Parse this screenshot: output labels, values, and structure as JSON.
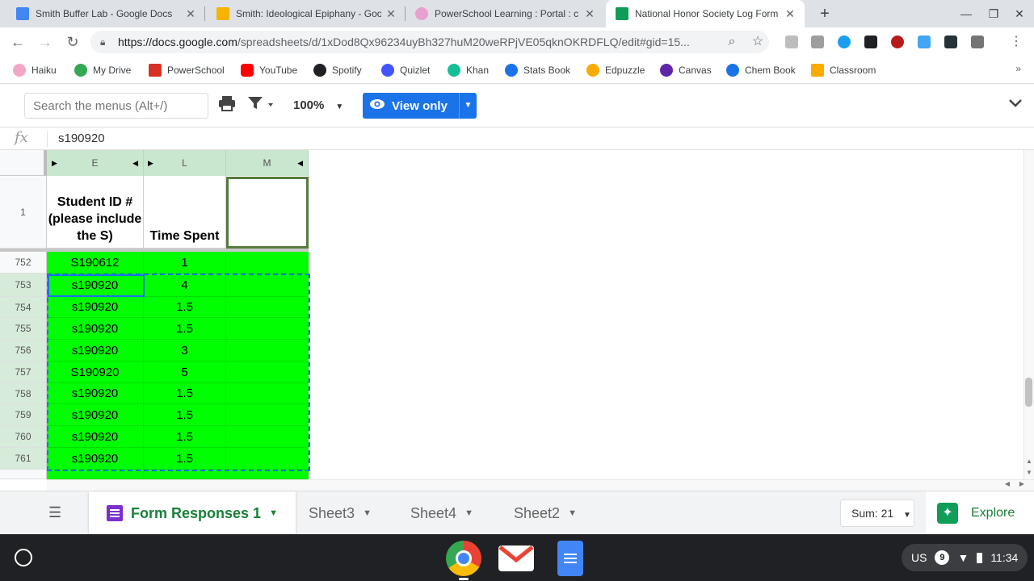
{
  "browser": {
    "tabs": [
      {
        "title": "Smith Buffer Lab - Google Docs",
        "favicon_color": "#4285f4"
      },
      {
        "title": "Smith: Ideological Epiphany - Goo",
        "favicon_color": "#f4b400"
      },
      {
        "title": "PowerSchool Learning : Portal : c",
        "favicon_color": "#e8a0d0"
      },
      {
        "title": "National Honor Society Log Form",
        "favicon_color": "#0f9d58"
      }
    ],
    "url_host": "https://docs.google.com",
    "url_path": "/spreadsheets/d/1xDod8Qx96234uyBh327huM20weRPjVE05qknOKRDFLQ/edit#gid=15...",
    "bookmarks": [
      {
        "label": "Haiku",
        "color": "#f4a6c7"
      },
      {
        "label": "My Drive",
        "color": "#34a853"
      },
      {
        "label": "PowerSchool",
        "color": "#d93025"
      },
      {
        "label": "YouTube",
        "color": "#ff0000"
      },
      {
        "label": "Spotify",
        "color": "#202124"
      },
      {
        "label": "Quizlet",
        "color": "#4255ff"
      },
      {
        "label": "Khan",
        "color": "#14bf96"
      },
      {
        "label": "Stats Book",
        "color": "#1a73e8"
      },
      {
        "label": "Edpuzzle",
        "color": "#f9ab00"
      },
      {
        "label": "Canvas",
        "color": "#5f27a8"
      },
      {
        "label": "Chem Book",
        "color": "#1a73e8"
      },
      {
        "label": "Classroom",
        "color": "#f9ab00"
      }
    ],
    "bookmarks_more": "»"
  },
  "toolbar": {
    "search_placeholder": "Search the menus (Alt+/)",
    "zoom": "100%",
    "view_label": "View only"
  },
  "formula_bar": {
    "fx": "fx",
    "value": "s190920"
  },
  "grid": {
    "columns": [
      "E",
      "L",
      "M"
    ],
    "header_row_number": "1",
    "header_e": "Student ID # (please include the S)",
    "header_l": "Time Spent",
    "rows": [
      {
        "n": "752",
        "id": "S190612",
        "time": "1"
      },
      {
        "n": "753",
        "id": "s190920",
        "time": "4"
      },
      {
        "n": "754",
        "id": "s190920",
        "time": "1.5"
      },
      {
        "n": "755",
        "id": "s190920",
        "time": "1.5"
      },
      {
        "n": "756",
        "id": "s190920",
        "time": "3"
      },
      {
        "n": "757",
        "id": "S190920",
        "time": "5"
      },
      {
        "n": "758",
        "id": "s190920",
        "time": "1.5"
      },
      {
        "n": "759",
        "id": "s190920",
        "time": "1.5"
      },
      {
        "n": "760",
        "id": "s190920",
        "time": "1.5"
      },
      {
        "n": "761",
        "id": "s190920",
        "time": "1.5"
      }
    ],
    "highlight_color": "#00ff00"
  },
  "sheets": {
    "tabs": [
      "Form Responses 1",
      "Sheet3",
      "Sheet4",
      "Sheet2"
    ],
    "active": "Form Responses 1",
    "sum": "Sum: 21",
    "explore": "Explore"
  },
  "system": {
    "keyboard": "US",
    "notifications": "9",
    "time": "11:34"
  }
}
